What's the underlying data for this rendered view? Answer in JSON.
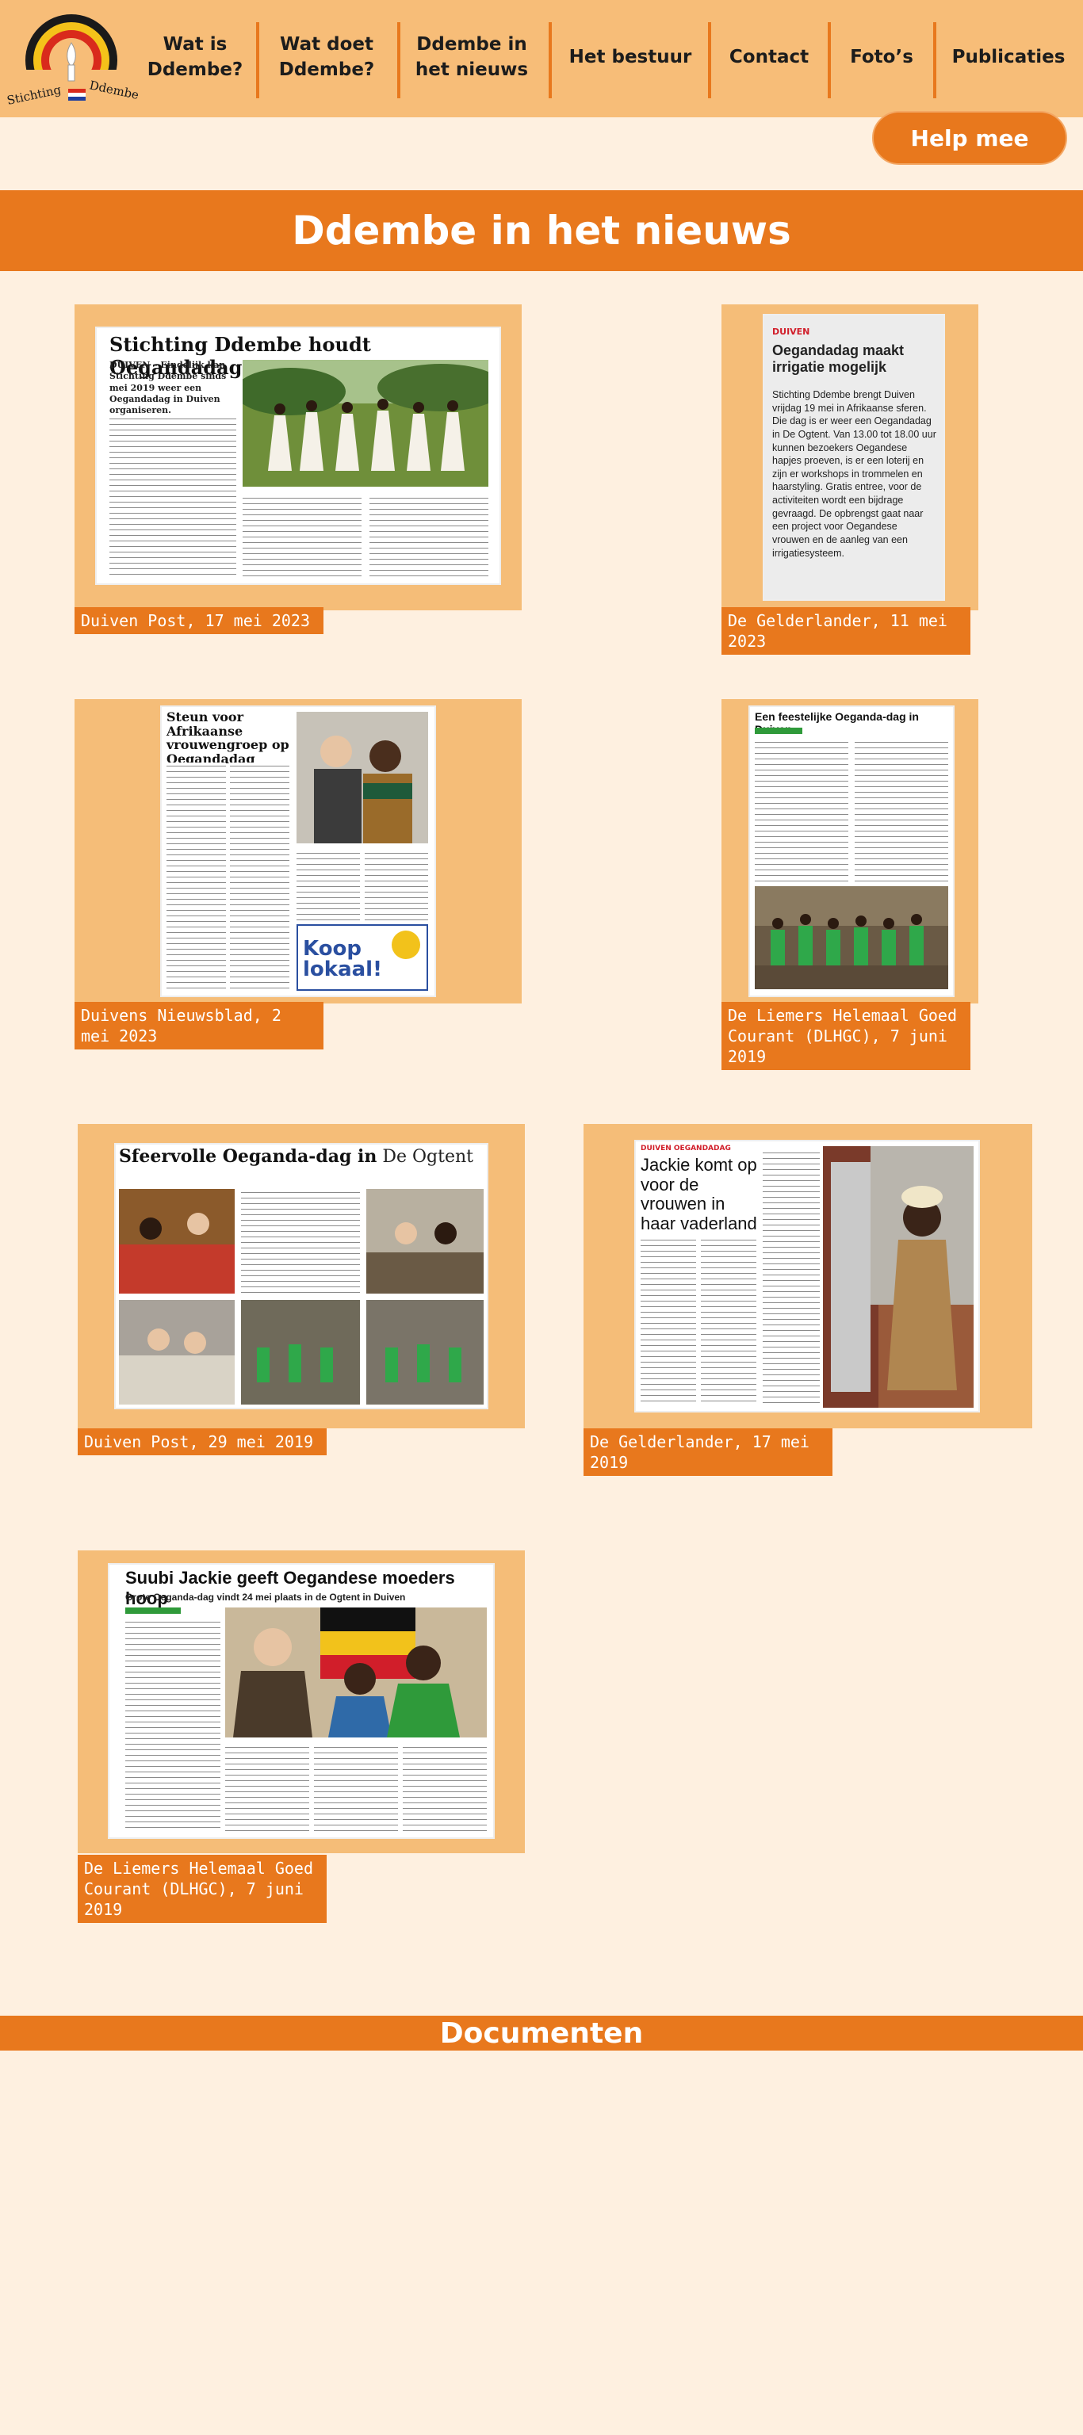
{
  "brand": {
    "logo_text": "Stichting Ddembe",
    "colors": {
      "orange": "#e8781d",
      "light_orange": "#f7bd78",
      "background": "#fef0e0"
    }
  },
  "nav": {
    "items": [
      {
        "line1": "Wat is",
        "line2": "Ddembe?"
      },
      {
        "line1": "Wat doet",
        "line2": "Ddembe?"
      },
      {
        "line1": "Ddembe in",
        "line2": "het nieuws"
      },
      {
        "line1": "Het bestuur",
        "line2": ""
      },
      {
        "line1": "Contact",
        "line2": ""
      },
      {
        "line1": "Foto’s",
        "line2": ""
      },
      {
        "line1": "Publicaties",
        "line2": ""
      }
    ]
  },
  "help_button": "Help mee",
  "page_title": "Ddembe in het nieuws",
  "documents_title": "Documenten",
  "articles": [
    {
      "caption": "Duiven Post, 17 mei 2023",
      "headline": "Stichting Ddembe houdt Oegandadag",
      "lead": "DUIVEN – Eindelijk kan Stichting Ddembe sinds mei 2019 weer een Oegandadag in Duiven organiseren."
    },
    {
      "caption": "De Gelderlander, 11 mei 2023",
      "kicker": "DUIVEN",
      "headline": "Oegandadag maakt irrigatie mogelijk",
      "body": "Stichting Ddembe brengt Duiven vrijdag 19 mei in Afrikaanse sferen. Die dag is er weer een Oegandadag in De Ogtent. Van 13.00 tot 18.00 uur kunnen bezoekers Oegandese hapjes proeven, is er een loterij en zijn er workshops in trommelen en haarstyling. Gratis entree, voor de activiteiten wordt een bijdrage gevraagd. De opbrengst gaat naar een project voor Oegandese vrouwen en de aanleg van een irrigatiesysteem."
    },
    {
      "caption": "Duivens Nieuwsblad, 2 mei 2023",
      "headline": "Steun voor Afrikaanse vrouwengroep op Oegandadag Duiven",
      "ad": "Koop lokaal!"
    },
    {
      "caption": "De Liemers Helemaal Goed Courant (DLHGC), 7 juni 2019",
      "headline": "Een feestelijke Oeganda-dag in Duiven"
    },
    {
      "caption": "Duiven Post, 29 mei 2019",
      "headline": "Sfeervolle Oeganda-dag in",
      "headline_tail": "De Ogtent"
    },
    {
      "caption": "De Gelderlander, 17 mei 2019",
      "kicker": "DUIVEN OEGANDADAG",
      "headline": "Jackie komt op voor de vrouwen in haar vaderland"
    },
    {
      "caption": "De Liemers Helemaal Goed Courant (DLHGC), 7 juni 2019",
      "headline": "Suubi Jackie geeft Oegandese moeders hoop",
      "subhead": "Grote Oeganda-dag vindt 24 mei plaats in de Ogtent in Duiven"
    }
  ]
}
